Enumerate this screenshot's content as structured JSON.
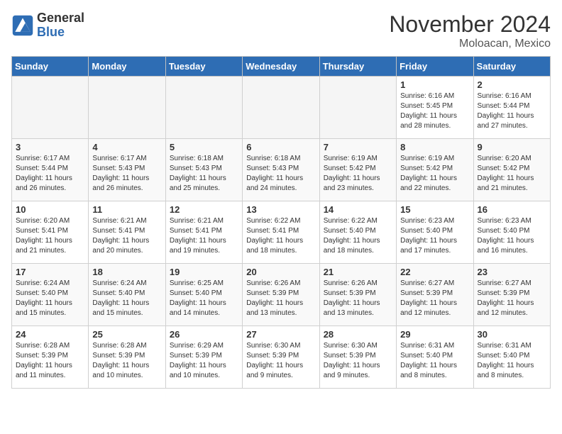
{
  "header": {
    "logo_line1": "General",
    "logo_line2": "Blue",
    "month_title": "November 2024",
    "location": "Moloacan, Mexico"
  },
  "weekdays": [
    "Sunday",
    "Monday",
    "Tuesday",
    "Wednesday",
    "Thursday",
    "Friday",
    "Saturday"
  ],
  "weeks": [
    [
      {
        "day": "",
        "info": ""
      },
      {
        "day": "",
        "info": ""
      },
      {
        "day": "",
        "info": ""
      },
      {
        "day": "",
        "info": ""
      },
      {
        "day": "",
        "info": ""
      },
      {
        "day": "1",
        "info": "Sunrise: 6:16 AM\nSunset: 5:45 PM\nDaylight: 11 hours\nand 28 minutes."
      },
      {
        "day": "2",
        "info": "Sunrise: 6:16 AM\nSunset: 5:44 PM\nDaylight: 11 hours\nand 27 minutes."
      }
    ],
    [
      {
        "day": "3",
        "info": "Sunrise: 6:17 AM\nSunset: 5:44 PM\nDaylight: 11 hours\nand 26 minutes."
      },
      {
        "day": "4",
        "info": "Sunrise: 6:17 AM\nSunset: 5:43 PM\nDaylight: 11 hours\nand 26 minutes."
      },
      {
        "day": "5",
        "info": "Sunrise: 6:18 AM\nSunset: 5:43 PM\nDaylight: 11 hours\nand 25 minutes."
      },
      {
        "day": "6",
        "info": "Sunrise: 6:18 AM\nSunset: 5:43 PM\nDaylight: 11 hours\nand 24 minutes."
      },
      {
        "day": "7",
        "info": "Sunrise: 6:19 AM\nSunset: 5:42 PM\nDaylight: 11 hours\nand 23 minutes."
      },
      {
        "day": "8",
        "info": "Sunrise: 6:19 AM\nSunset: 5:42 PM\nDaylight: 11 hours\nand 22 minutes."
      },
      {
        "day": "9",
        "info": "Sunrise: 6:20 AM\nSunset: 5:42 PM\nDaylight: 11 hours\nand 21 minutes."
      }
    ],
    [
      {
        "day": "10",
        "info": "Sunrise: 6:20 AM\nSunset: 5:41 PM\nDaylight: 11 hours\nand 21 minutes."
      },
      {
        "day": "11",
        "info": "Sunrise: 6:21 AM\nSunset: 5:41 PM\nDaylight: 11 hours\nand 20 minutes."
      },
      {
        "day": "12",
        "info": "Sunrise: 6:21 AM\nSunset: 5:41 PM\nDaylight: 11 hours\nand 19 minutes."
      },
      {
        "day": "13",
        "info": "Sunrise: 6:22 AM\nSunset: 5:41 PM\nDaylight: 11 hours\nand 18 minutes."
      },
      {
        "day": "14",
        "info": "Sunrise: 6:22 AM\nSunset: 5:40 PM\nDaylight: 11 hours\nand 18 minutes."
      },
      {
        "day": "15",
        "info": "Sunrise: 6:23 AM\nSunset: 5:40 PM\nDaylight: 11 hours\nand 17 minutes."
      },
      {
        "day": "16",
        "info": "Sunrise: 6:23 AM\nSunset: 5:40 PM\nDaylight: 11 hours\nand 16 minutes."
      }
    ],
    [
      {
        "day": "17",
        "info": "Sunrise: 6:24 AM\nSunset: 5:40 PM\nDaylight: 11 hours\nand 15 minutes."
      },
      {
        "day": "18",
        "info": "Sunrise: 6:24 AM\nSunset: 5:40 PM\nDaylight: 11 hours\nand 15 minutes."
      },
      {
        "day": "19",
        "info": "Sunrise: 6:25 AM\nSunset: 5:40 PM\nDaylight: 11 hours\nand 14 minutes."
      },
      {
        "day": "20",
        "info": "Sunrise: 6:26 AM\nSunset: 5:39 PM\nDaylight: 11 hours\nand 13 minutes."
      },
      {
        "day": "21",
        "info": "Sunrise: 6:26 AM\nSunset: 5:39 PM\nDaylight: 11 hours\nand 13 minutes."
      },
      {
        "day": "22",
        "info": "Sunrise: 6:27 AM\nSunset: 5:39 PM\nDaylight: 11 hours\nand 12 minutes."
      },
      {
        "day": "23",
        "info": "Sunrise: 6:27 AM\nSunset: 5:39 PM\nDaylight: 11 hours\nand 12 minutes."
      }
    ],
    [
      {
        "day": "24",
        "info": "Sunrise: 6:28 AM\nSunset: 5:39 PM\nDaylight: 11 hours\nand 11 minutes."
      },
      {
        "day": "25",
        "info": "Sunrise: 6:28 AM\nSunset: 5:39 PM\nDaylight: 11 hours\nand 10 minutes."
      },
      {
        "day": "26",
        "info": "Sunrise: 6:29 AM\nSunset: 5:39 PM\nDaylight: 11 hours\nand 10 minutes."
      },
      {
        "day": "27",
        "info": "Sunrise: 6:30 AM\nSunset: 5:39 PM\nDaylight: 11 hours\nand 9 minutes."
      },
      {
        "day": "28",
        "info": "Sunrise: 6:30 AM\nSunset: 5:39 PM\nDaylight: 11 hours\nand 9 minutes."
      },
      {
        "day": "29",
        "info": "Sunrise: 6:31 AM\nSunset: 5:40 PM\nDaylight: 11 hours\nand 8 minutes."
      },
      {
        "day": "30",
        "info": "Sunrise: 6:31 AM\nSunset: 5:40 PM\nDaylight: 11 hours\nand 8 minutes."
      }
    ]
  ]
}
